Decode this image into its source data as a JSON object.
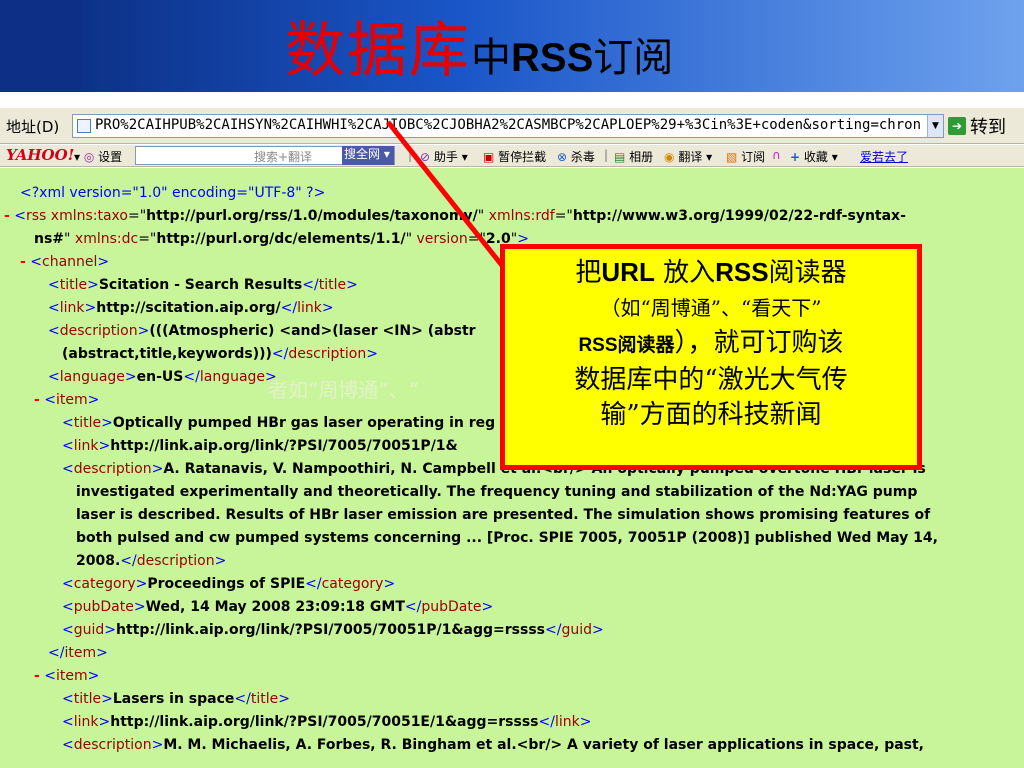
{
  "slide": {
    "title_main": "数据库",
    "title_sub_pre": "中",
    "title_sub_bold": "RSS",
    "title_sub_post": "订阅"
  },
  "address_bar": {
    "label": "地址(D)",
    "url": "PRO%2CAIHPUB%2CAIHSYN%2CAIHWHI%2CAJIOBC%2CJOBHA2%2CASMBCP%2CAPLOEP%29+%3Cin%3E+coden&sorting=chron",
    "go_label": "转到"
  },
  "yahoo_toolbar": {
    "logo": "YAHOO!",
    "settings": "设置",
    "search_placeholder": "搜索+翻译",
    "search_button": "搜全网",
    "helper": "助手",
    "block_popup": "暂停拦截",
    "antivirus": "杀毒",
    "album": "相册",
    "translate": "翻译",
    "subscribe": "订阅",
    "favorites": "收藏",
    "amorous": "爱若去了"
  },
  "xml": {
    "decl": "<?xml version=\"1.0\" encoding=\"UTF-8\" ?>",
    "rss_ns_taxo_attr": "xmlns:taxo",
    "rss_ns_taxo_val": "http://purl.org/rss/1.0/modules/taxonomy/",
    "rss_ns_rdf_attr": "xmlns:rdf",
    "rss_ns_rdf_val": "http://www.w3.org/1999/02/22-rdf-syntax-",
    "rss_ns_rdf_cont": "ns#",
    "rss_ns_dc_attr": "xmlns:dc",
    "rss_ns_dc_val": "http://purl.org/dc/elements/1.1/",
    "rss_version_attr": "version",
    "rss_version_val": "2.0",
    "channel_title": "Scitation - Search Results",
    "channel_link": "http://scitation.aip.org/",
    "channel_description_1": "(((Atmospheric) <and>(laser <IN> (abstr",
    "channel_description_2": "(abstract,title,keywords)))",
    "channel_language": "en-US",
    "items": [
      {
        "title": "Optically pumped HBr gas laser operating in reg",
        "link": "http://link.aip.org/link/?PSI/7005/70051P/1&",
        "description_lines": [
          "A. Ratanavis, V. Nampoothiri, N. Campbell et al.<br/> An optically pumped overtone HBr laser is",
          "investigated experimentally and theoretically. The frequency tuning and stabilization of the Nd:YAG pump",
          "laser is described. Results of HBr laser emission are presented. The simulation shows promising features of",
          "both pulsed and cw pumped systems concerning ... [Proc. SPIE 7005, 70051P (2008)] published Wed May 14,",
          "2008."
        ],
        "category": "Proceedings of SPIE",
        "pubDate": "Wed, 14 May 2008 23:09:18 GMT",
        "guid": "http://link.aip.org/link/?PSI/7005/70051P/1&agg=rssss"
      },
      {
        "title": "Lasers in space",
        "link": "http://link.aip.org/link/?PSI/7005/70051E/1&agg=rssss",
        "description_lines": [
          "M. M. Michaelis, A. Forbes, R. Bingham et al.<br/> A variety of laser applications in space, past,"
        ]
      }
    ]
  },
  "callout": {
    "line1_pre": "把",
    "line1_url": "URL",
    "line1_mid": " 放入",
    "line1_rss": "RSS",
    "line1_post": "阅读器",
    "line2": "（如“周博通”、“看天下”",
    "line3_rss": "RSS阅读器",
    "line3_post": "），就可订购该",
    "line4": "数据库中的“激光大气传",
    "line5": "输”方面的科技新闻"
  },
  "ghost_text": "者如“周博通”、“",
  "colors": {
    "content_bg": "#c9f59a",
    "callout_bg": "#ffff00",
    "callout_border": "#ff0000",
    "title_red": "#e60000",
    "xml_tag": "#990000",
    "xml_bracket": "#0000ff"
  }
}
